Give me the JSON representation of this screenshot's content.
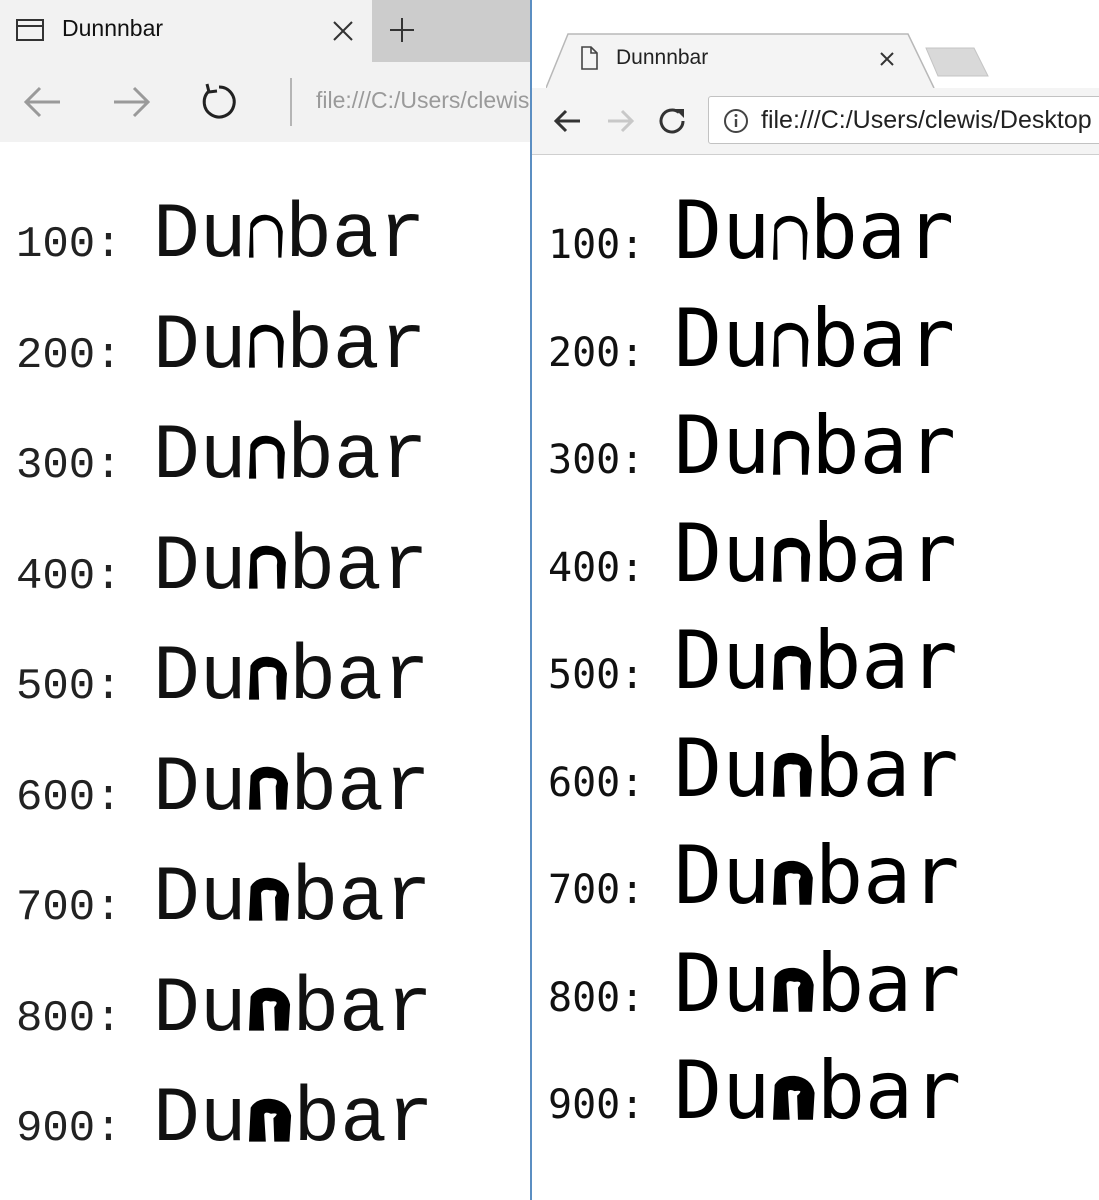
{
  "left_window": {
    "tab_title": "Dunnnbar",
    "url": "file:///C:/Users/clewis",
    "icons": {
      "tab": "page-icon",
      "close": "close-icon",
      "new_tab": "plus-icon",
      "back": "arrow-left-icon",
      "forward": "arrow-right-icon",
      "refresh": "refresh-icon"
    }
  },
  "right_window": {
    "tab_title": "Dunnnbar",
    "url": "file:///C:/Users/clewis/Desktop",
    "icons": {
      "tab": "document-icon",
      "close": "close-icon",
      "back": "arrow-left-icon",
      "forward": "arrow-right-icon",
      "reload": "reload-icon",
      "info": "info-icon"
    }
  },
  "samples": [
    {
      "label": "100:",
      "prefix": "Du",
      "suffix": "bar",
      "weight": 100
    },
    {
      "label": "200:",
      "prefix": "Du",
      "suffix": "bar",
      "weight": 200
    },
    {
      "label": "300:",
      "prefix": "Du",
      "suffix": "bar",
      "weight": 300
    },
    {
      "label": "400:",
      "prefix": "Du",
      "suffix": "bar",
      "weight": 400
    },
    {
      "label": "500:",
      "prefix": "Du",
      "suffix": "bar",
      "weight": 500
    },
    {
      "label": "600:",
      "prefix": "Du",
      "suffix": "bar",
      "weight": 600
    },
    {
      "label": "700:",
      "prefix": "Du",
      "suffix": "bar",
      "weight": 700
    },
    {
      "label": "800:",
      "prefix": "Du",
      "suffix": "bar",
      "weight": 800
    },
    {
      "label": "900:",
      "prefix": "Du",
      "suffix": "bar",
      "weight": 900
    }
  ]
}
